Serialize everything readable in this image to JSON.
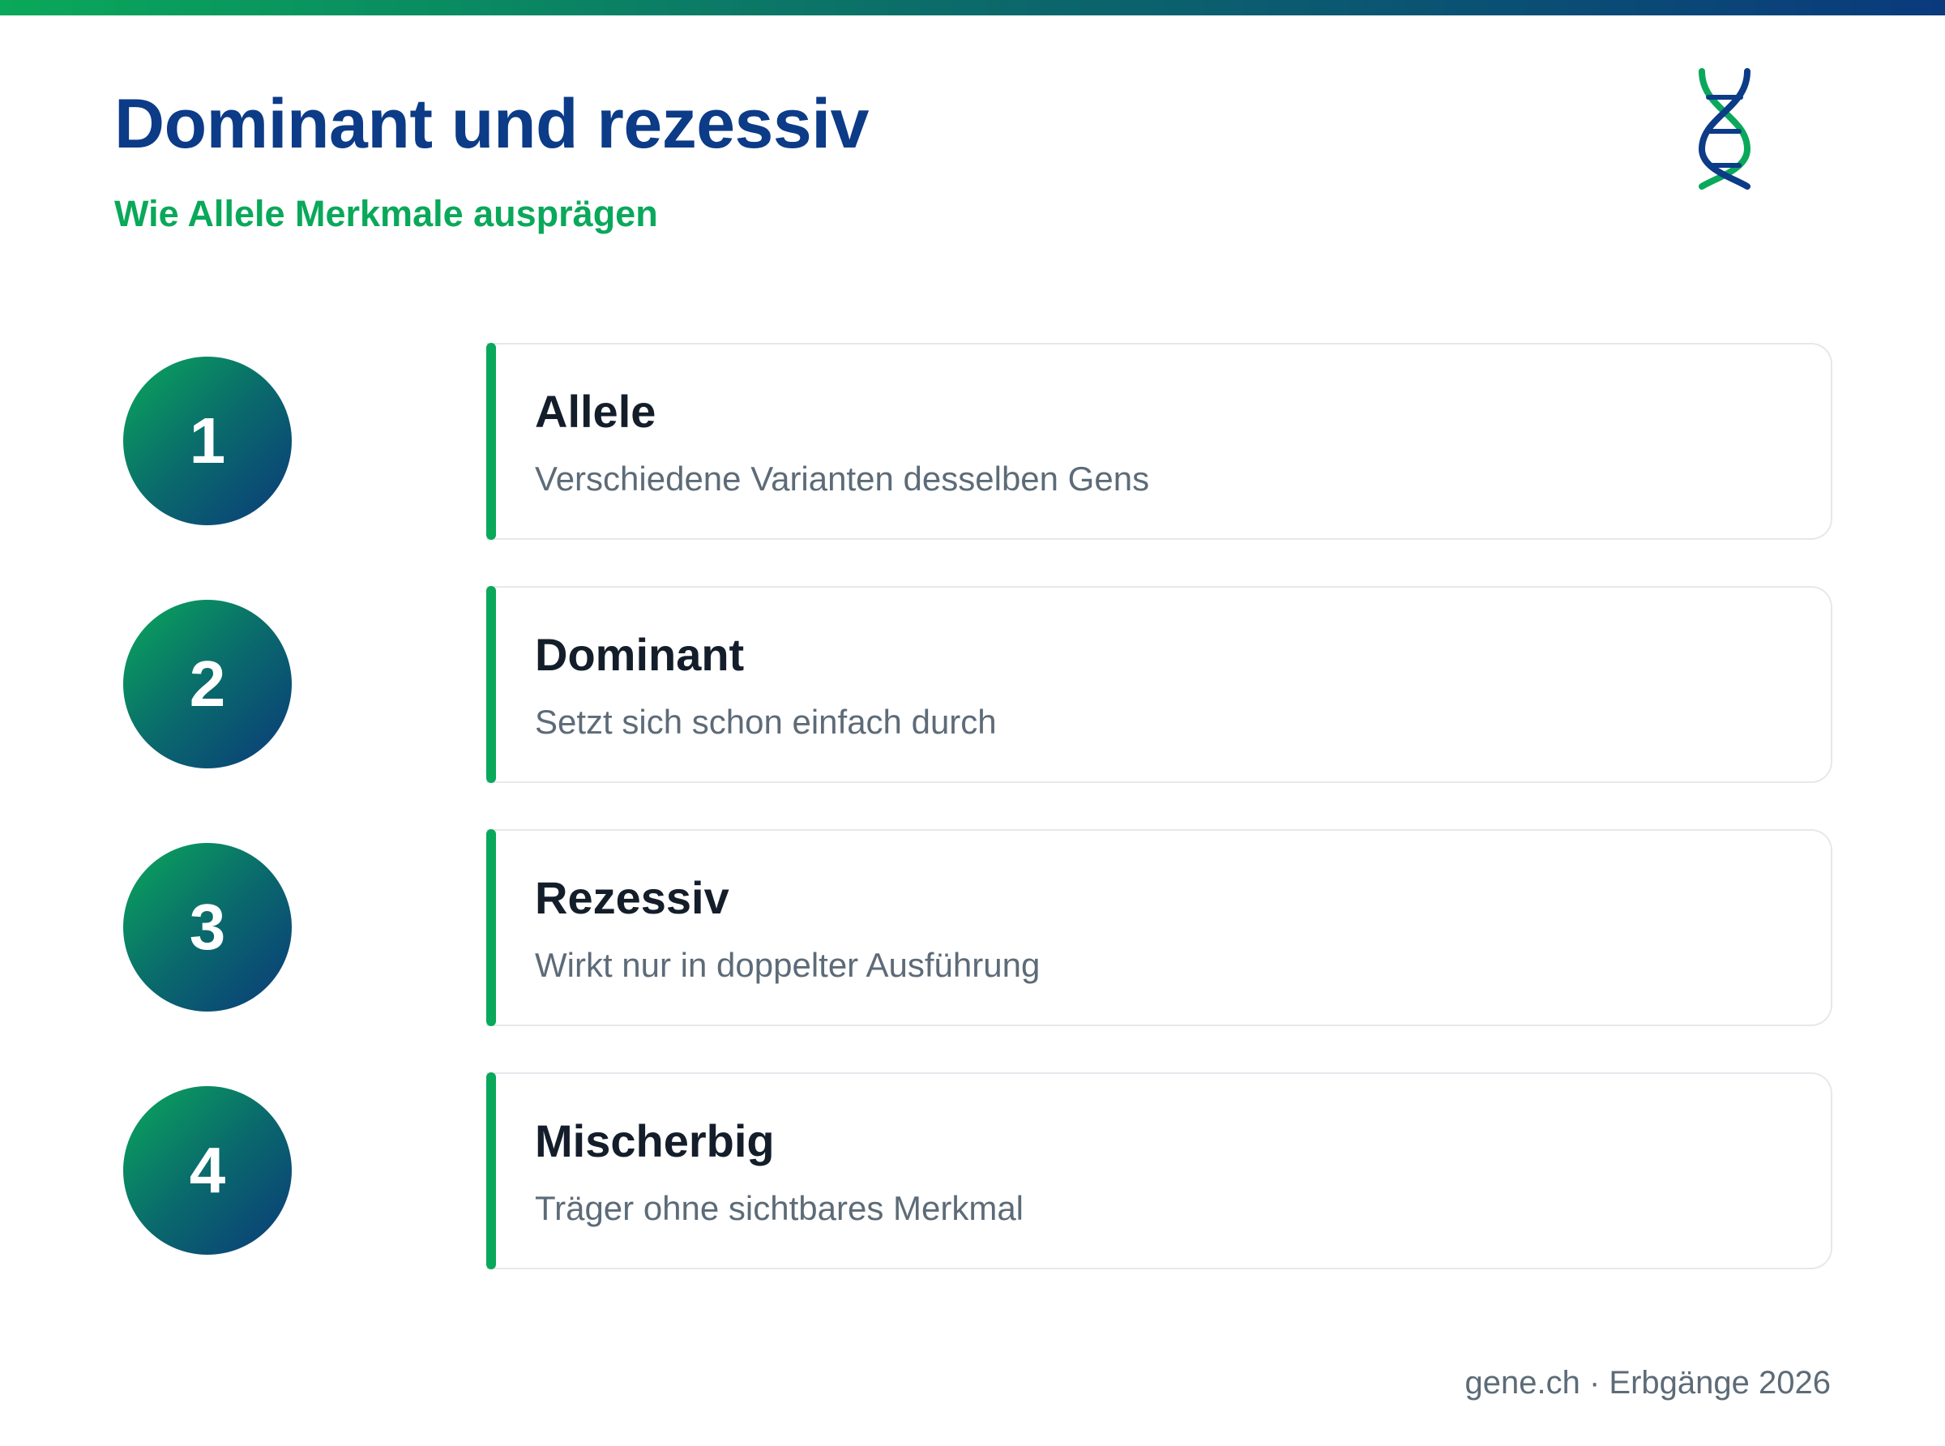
{
  "header": {
    "title": "Dominant und rezessiv",
    "subtitle": "Wie Allele Merkmale ausprägen",
    "logo_icon": "dna-icon"
  },
  "colors": {
    "title": "#0c3b87",
    "accent_green": "#0aa85a",
    "card_title": "#141e2b",
    "card_text": "#5d6b78"
  },
  "items": [
    {
      "number": "1",
      "title": "Allele",
      "text": "Verschiedene Varianten desselben Gens"
    },
    {
      "number": "2",
      "title": "Dominant",
      "text": "Setzt sich schon einfach durch"
    },
    {
      "number": "3",
      "title": "Rezessiv",
      "text": "Wirkt nur in doppelter Ausführung"
    },
    {
      "number": "4",
      "title": "Mischerbig",
      "text": "Träger ohne sichtbares Merkmal"
    }
  ],
  "footer": {
    "text": "gene.ch · Erbgänge 2026"
  }
}
